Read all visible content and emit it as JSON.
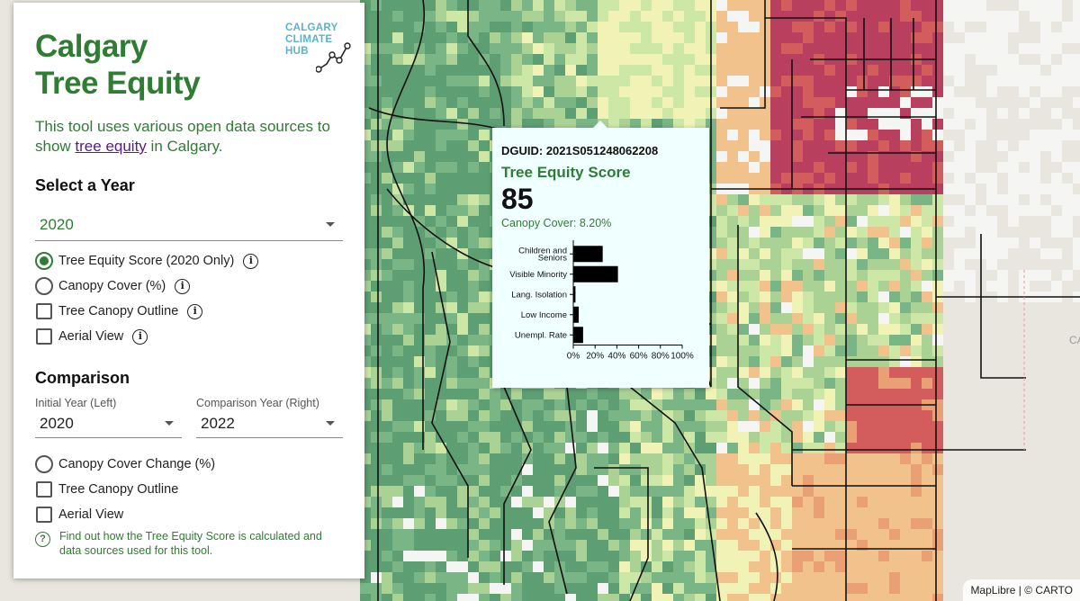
{
  "panel": {
    "title_line1": "Calgary",
    "title_line2": "Tree Equity",
    "logo": {
      "line1": "CALGARY",
      "line2": "CLIMATE",
      "line3": "HUB"
    },
    "intro_prefix": "This tool uses various open data sources to show ",
    "intro_link": "tree equity",
    "intro_suffix": " in Calgary.",
    "year_heading": "Select a Year",
    "year_value": "2020",
    "layers": [
      {
        "label": "Tree Equity Score (2020 Only)",
        "type": "radio",
        "checked": true,
        "info": true
      },
      {
        "label": "Canopy Cover (%)",
        "type": "radio",
        "checked": false,
        "info": true
      },
      {
        "label": "Tree Canopy Outline",
        "type": "checkbox",
        "checked": false,
        "info": true
      },
      {
        "label": "Aerial View",
        "type": "checkbox",
        "checked": false,
        "info": true
      }
    ],
    "comparison_heading": "Comparison",
    "initial_year_label": "Initial Year (Left)",
    "initial_year_value": "2020",
    "comparison_year_label": "Comparison Year (Right)",
    "comparison_year_value": "2022",
    "comparison_layers": [
      {
        "label": "Canopy Cover Change (%)",
        "type": "radio",
        "checked": false
      },
      {
        "label": "Tree Canopy Outline",
        "type": "checkbox",
        "checked": false
      },
      {
        "label": "Aerial View",
        "type": "checkbox",
        "checked": false
      }
    ],
    "footer_note": "Find out how the Tree Equity Score is calculated and data sources used for this tool.",
    "info_icon_glyph": "i",
    "help_icon_glyph": "?"
  },
  "popup": {
    "dguid": "DGUID: 2021S051248062208",
    "score_label": "Tree Equity Score",
    "score": "85",
    "canopy": "Canopy Cover: 8.20%"
  },
  "chart_data": {
    "type": "bar",
    "orientation": "horizontal",
    "categories": [
      "Children and Seniors",
      "Visible Minority",
      "Lang. Isolation",
      "Low Income",
      "Unempl. Rate"
    ],
    "values": [
      27,
      41,
      2,
      5,
      9
    ],
    "xlim": [
      0,
      100
    ],
    "xticks": [
      "0%",
      "20%",
      "40%",
      "60%",
      "80%",
      "100%"
    ],
    "bar_color": "#000000"
  },
  "map": {
    "colors": {
      "dark_green": "#5d9e72",
      "green": "#79b585",
      "light_green": "#a9d294",
      "pale_green": "#cde7a6",
      "yellow": "#f1f2b5",
      "orange": "#f2c28c",
      "dark_orange": "#e8a074",
      "red": "#d35d5d",
      "dark_red": "#b8405e",
      "white": "#f5f5f3",
      "road_line": "#111111"
    },
    "label_partial": "CARTO"
  },
  "attribution": "MapLibre | © CARTO",
  "colors": {
    "accent": "#2e7d32",
    "link": "#551a8b",
    "popup_bg": "#f0ffff"
  }
}
